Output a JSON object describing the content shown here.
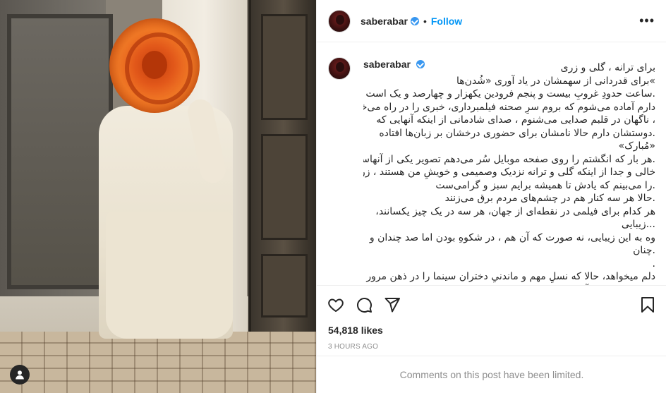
{
  "post": {
    "username": "saberabar",
    "follow_label": "Follow",
    "dot": "•",
    "more_label": "•••",
    "caption": [
      "برای ترانه ، گلی و زری",
      "»برای قدردانی از سهمشان در یاد آوری «شُدن‌ها",
      ".ساعت حدودِ غروبِ بیست و پنجم فرودین یکهزار و چهارصد و یک است",
      "دارم آماده می‌شوم که بروم سرِ صحنه فیلمبرداری، خبری را در راه می‌خوانم",
      "، ناگهان در قلبم صدایی می‌شنوم ، صدای شادمانی از اینکه آنهایی که",
      ".دوستشان دارم حالا نامشان برای حضوری درخشان بر زبان‌ها افتاده",
      "«مُبارک»",
      ".هر بار که انگشتم را روی صفحه موبایل سُر می‌دهم تصویر یکی از آنهاست",
      "خالی و جدا از اینکه گلی و ترانه نزدیک وصمیمی و خویشِ من هستند ، زری",
      ".را می‌بینم که یادش تا همیشه برایم سبز و گرامی‌ست",
      ".حالا هر سه کنار هم در چشم‌های مردم برق می‌زنند",
      "هر کدام برای فیلمی در نقطه‌ای از جهان، هر سه در یک چیز یکسانند،",
      "...زیبایی",
      "وه به این زیبایی، نه صورت که آن هم ، در شکوهِ بودن اما صد چندان و",
      ".چنان",
      ".",
      "دلم میخواهد، حالا که نسلِ مهم و ماندنیِ دختران سینما را در ذهن مرور",
      "میکنم یاد همه‌ی آنها کنم که سختی‌های سال‌های اخیر به دلیل مهاجرت یاد زنی"
    ],
    "likes": "54,818 likes",
    "time": "3 HOURS AGO",
    "comments_limited": "Comments on this post have been limited."
  },
  "icons": {
    "verified": "verified-badge-icon",
    "like": "heart-icon",
    "comment": "comment-bubble-icon",
    "share": "paper-plane-icon",
    "save": "bookmark-icon",
    "tag": "user-tag-icon",
    "more": "more-options-icon"
  },
  "colors": {
    "accent": "#0095f6",
    "verified": "#3897f0",
    "muted": "#8e8e8e",
    "text": "#262626"
  }
}
